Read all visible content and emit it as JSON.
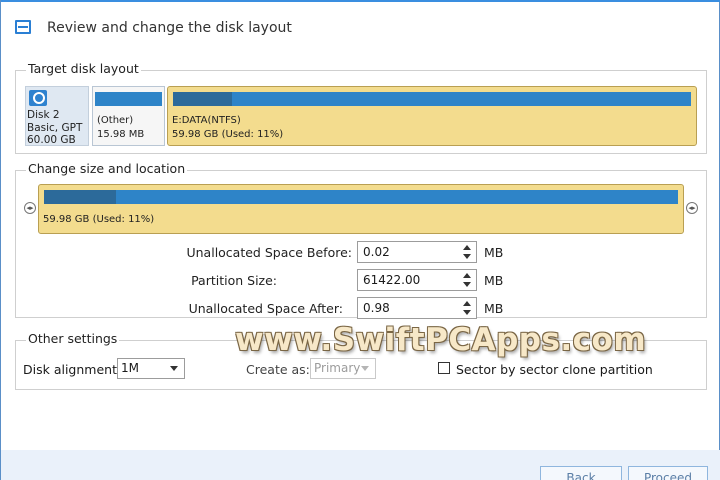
{
  "window": {
    "title": "Review and change the disk layout"
  },
  "target_panel": {
    "title": "Target disk layout"
  },
  "disk": {
    "name": "Disk 2",
    "type": "Basic, GPT",
    "size": "60.00 GB"
  },
  "partitions": [
    {
      "label": "(Other)",
      "size": "15.98 MB",
      "used_fraction": 1.0
    },
    {
      "label": "E:DATA(NTFS)",
      "size": "59.98 GB (Used: 11%)",
      "used_fraction": 0.11
    }
  ],
  "resize_panel": {
    "title": "Change size and location",
    "bar_text": "59.98 GB (Used: 11%)",
    "used_fraction": 0.11,
    "fields": [
      {
        "label": "Unallocated Space Before:",
        "value": "0.02",
        "unit": "MB"
      },
      {
        "label": "Partition Size:",
        "value": "61422.00",
        "unit": "MB"
      },
      {
        "label": "Unallocated Space After:",
        "value": "0.98",
        "unit": "MB"
      }
    ]
  },
  "other_settings": {
    "title": "Other settings",
    "alignment_label": "Disk alignment:",
    "alignment_value": "1M",
    "create_as_label": "Create as:",
    "create_as_value": "Primary",
    "clone_label": "Sector by sector clone partition",
    "clone_checked": false
  },
  "watermark": "www.SwiftPCApps.com",
  "footer": {
    "back_label": "Back",
    "proceed_label": "Proceed"
  },
  "colors": {
    "accent": "#2e84c8",
    "partition_fill": "#f3dc8e",
    "partition_border": "#b99f52"
  }
}
